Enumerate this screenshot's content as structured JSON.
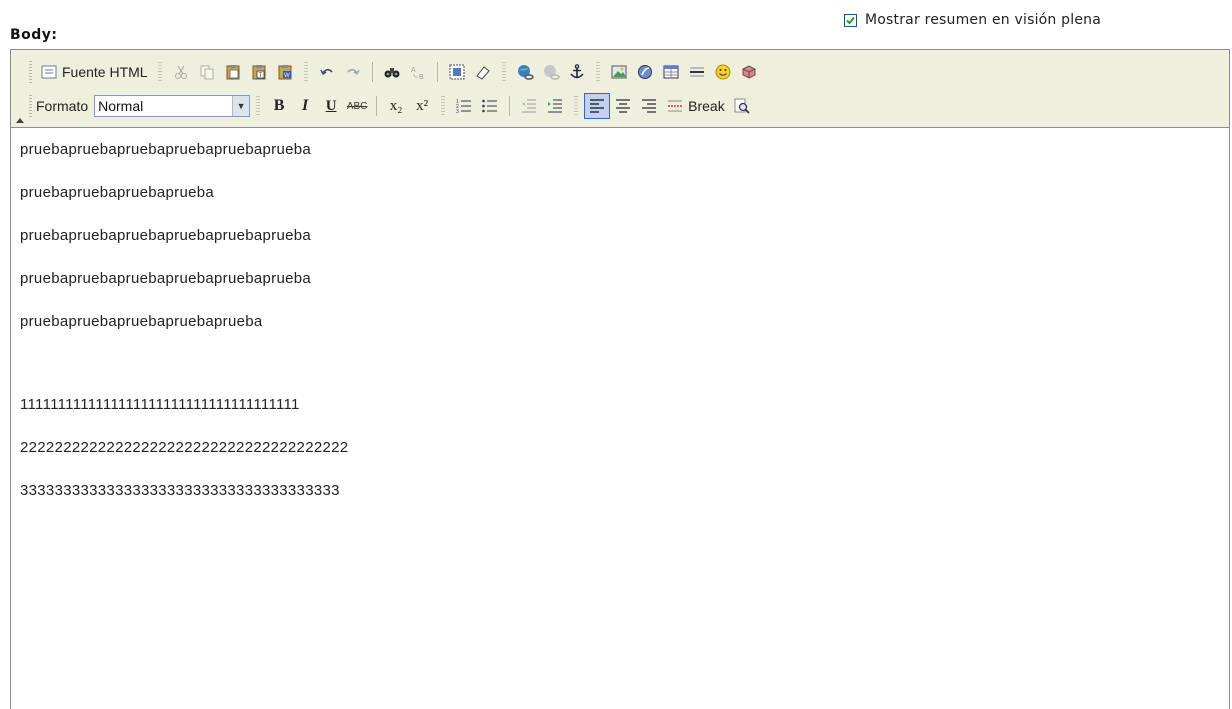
{
  "options": {
    "show_summary_label": "Mostrar resumen en visión plena",
    "show_summary_checked": true
  },
  "field_label": "Body:",
  "toolbar": {
    "source_label": "Fuente HTML",
    "format_label": "Formato",
    "format_value": "Normal",
    "break_label": "Break",
    "bold": "B",
    "italic": "I",
    "underline": "U",
    "strike": "ABC",
    "subscript": "x₂",
    "superscript": "x²"
  },
  "content": {
    "lines": [
      "pruebapruebapruebapruebapruebaprueba",
      "pruebapruebapruebaprueba",
      "pruebapruebapruebapruebapruebaprueba",
      "pruebapruebapruebapruebapruebaprueba",
      "pruebapruebapruebapruebaprueba",
      "",
      "1111111111111111111111111111111111111",
      "22222222222222222222222222222222222222",
      "3333333333333333333333333333333333333"
    ]
  },
  "colors": {
    "toolbar_bg": "#efefde",
    "pressed_bg": "#c1d2ee",
    "border": "#8c8c8c"
  }
}
